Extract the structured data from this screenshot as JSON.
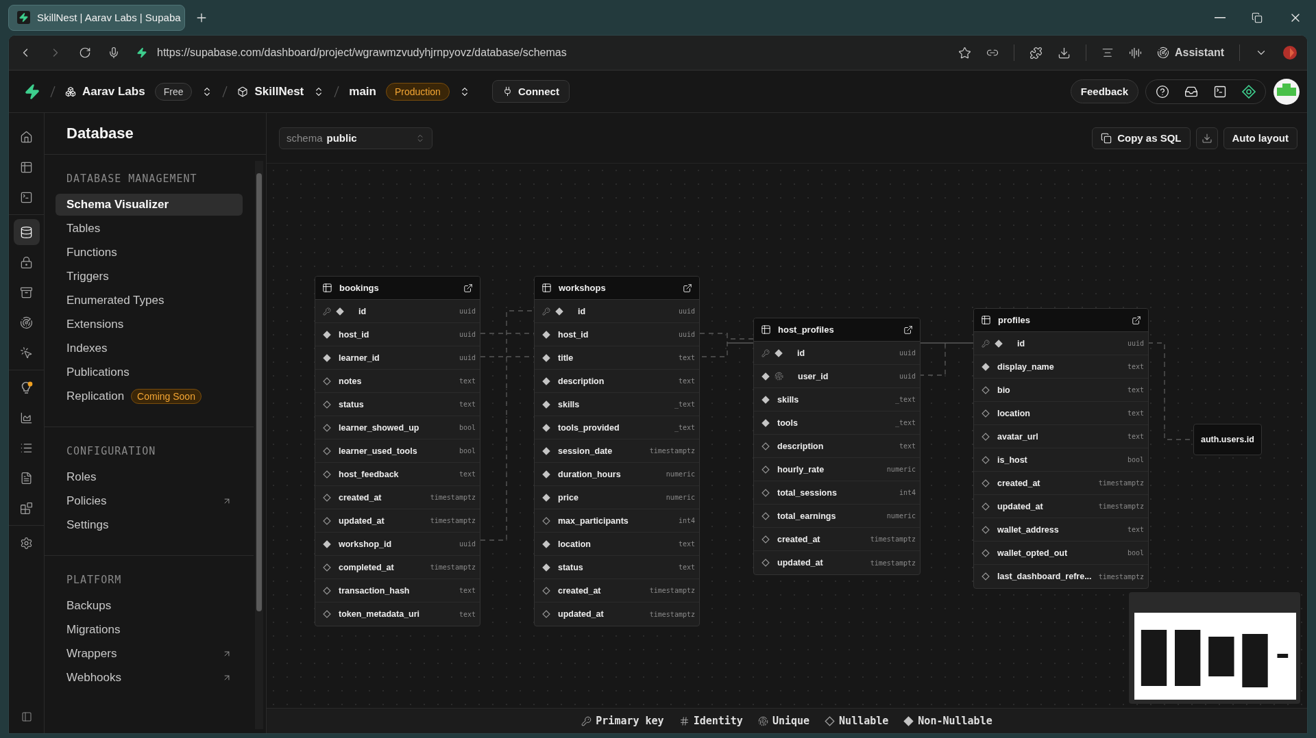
{
  "browser": {
    "tab_title": "SkillNest | Aarav Labs | Supaba",
    "url": "https://supabase.com/dashboard/project/wgrawmzvudyhjrnpyovz/database/schemas",
    "assistant": "Assistant"
  },
  "header": {
    "org": "Aarav Labs",
    "plan": "Free",
    "project": "SkillNest",
    "branch": "main",
    "environment": "Production",
    "connect": "Connect",
    "feedback": "Feedback"
  },
  "rail_groups": [
    {
      "items": [
        {
          "kind": "home",
          "selected": false
        },
        {
          "kind": "table",
          "selected": false
        },
        {
          "kind": "terminal",
          "selected": false
        }
      ]
    },
    {
      "items": [
        {
          "kind": "database",
          "selected": true
        },
        {
          "kind": "auth",
          "selected": false
        },
        {
          "kind": "storage",
          "selected": false
        },
        {
          "kind": "realtime",
          "selected": false
        },
        {
          "kind": "functions",
          "selected": false
        }
      ]
    },
    {
      "items": [
        {
          "kind": "advisor",
          "selected": false
        },
        {
          "kind": "reports",
          "selected": false
        },
        {
          "kind": "logs",
          "selected": false
        },
        {
          "kind": "docs",
          "selected": false
        },
        {
          "kind": "integrations",
          "selected": false
        }
      ]
    },
    {
      "items": [
        {
          "kind": "settings",
          "selected": false
        }
      ]
    }
  ],
  "sidebar": {
    "title": "Database",
    "sections": [
      {
        "heading": "DATABASE MANAGEMENT",
        "items": [
          {
            "label": "Schema Visualizer",
            "selected": true
          },
          {
            "label": "Tables",
            "selected": false
          },
          {
            "label": "Functions",
            "selected": false
          },
          {
            "label": "Triggers",
            "selected": false
          },
          {
            "label": "Enumerated Types",
            "selected": false
          },
          {
            "label": "Extensions",
            "selected": false
          },
          {
            "label": "Indexes",
            "selected": false
          },
          {
            "label": "Publications",
            "selected": false
          },
          {
            "label": "Replication",
            "selected": false,
            "badge": "Coming Soon"
          }
        ]
      },
      {
        "heading": "CONFIGURATION",
        "items": [
          {
            "label": "Roles",
            "selected": false
          },
          {
            "label": "Policies",
            "selected": false,
            "external": true
          },
          {
            "label": "Settings",
            "selected": false
          }
        ]
      },
      {
        "heading": "PLATFORM",
        "items": [
          {
            "label": "Backups",
            "selected": false
          },
          {
            "label": "Migrations",
            "selected": false
          },
          {
            "label": "Wrappers",
            "selected": false,
            "external": true
          },
          {
            "label": "Webhooks",
            "selected": false,
            "external": true
          }
        ]
      }
    ]
  },
  "toolbar": {
    "schema_label": "schema",
    "schema_value": "public",
    "copy_sql": "Copy as SQL",
    "auto_layout": "Auto layout"
  },
  "tables": [
    {
      "name": "bookings",
      "columns": [
        {
          "name": "id",
          "type": "uuid",
          "primary_key": true,
          "unique": false,
          "nullable": false
        },
        {
          "name": "host_id",
          "type": "uuid",
          "primary_key": false,
          "unique": false,
          "nullable": false
        },
        {
          "name": "learner_id",
          "type": "uuid",
          "primary_key": false,
          "unique": false,
          "nullable": false
        },
        {
          "name": "notes",
          "type": "text",
          "primary_key": false,
          "unique": false,
          "nullable": true
        },
        {
          "name": "status",
          "type": "text",
          "primary_key": false,
          "unique": false,
          "nullable": true
        },
        {
          "name": "learner_showed_up",
          "type": "bool",
          "primary_key": false,
          "unique": false,
          "nullable": true
        },
        {
          "name": "learner_used_tools",
          "type": "bool",
          "primary_key": false,
          "unique": false,
          "nullable": true
        },
        {
          "name": "host_feedback",
          "type": "text",
          "primary_key": false,
          "unique": false,
          "nullable": true
        },
        {
          "name": "created_at",
          "type": "timestamptz",
          "primary_key": false,
          "unique": false,
          "nullable": true
        },
        {
          "name": "updated_at",
          "type": "timestamptz",
          "primary_key": false,
          "unique": false,
          "nullable": true
        },
        {
          "name": "workshop_id",
          "type": "uuid",
          "primary_key": false,
          "unique": false,
          "nullable": false
        },
        {
          "name": "completed_at",
          "type": "timestamptz",
          "primary_key": false,
          "unique": false,
          "nullable": true
        },
        {
          "name": "transaction_hash",
          "type": "text",
          "primary_key": false,
          "unique": false,
          "nullable": true
        },
        {
          "name": "token_metadata_uri",
          "type": "text",
          "primary_key": false,
          "unique": false,
          "nullable": true
        }
      ]
    },
    {
      "name": "workshops",
      "columns": [
        {
          "name": "id",
          "type": "uuid",
          "primary_key": true,
          "unique": false,
          "nullable": false
        },
        {
          "name": "host_id",
          "type": "uuid",
          "primary_key": false,
          "unique": false,
          "nullable": false
        },
        {
          "name": "title",
          "type": "text",
          "primary_key": false,
          "unique": false,
          "nullable": false
        },
        {
          "name": "description",
          "type": "text",
          "primary_key": false,
          "unique": false,
          "nullable": false
        },
        {
          "name": "skills",
          "type": "_text",
          "primary_key": false,
          "unique": false,
          "nullable": false
        },
        {
          "name": "tools_provided",
          "type": "_text",
          "primary_key": false,
          "unique": false,
          "nullable": false
        },
        {
          "name": "session_date",
          "type": "timestamptz",
          "primary_key": false,
          "unique": false,
          "nullable": false
        },
        {
          "name": "duration_hours",
          "type": "numeric",
          "primary_key": false,
          "unique": false,
          "nullable": false
        },
        {
          "name": "price",
          "type": "numeric",
          "primary_key": false,
          "unique": false,
          "nullable": false
        },
        {
          "name": "max_participants",
          "type": "int4",
          "primary_key": false,
          "unique": false,
          "nullable": true
        },
        {
          "name": "location",
          "type": "text",
          "primary_key": false,
          "unique": false,
          "nullable": false
        },
        {
          "name": "status",
          "type": "text",
          "primary_key": false,
          "unique": false,
          "nullable": false
        },
        {
          "name": "created_at",
          "type": "timestamptz",
          "primary_key": false,
          "unique": false,
          "nullable": true
        },
        {
          "name": "updated_at",
          "type": "timestamptz",
          "primary_key": false,
          "unique": false,
          "nullable": true
        }
      ]
    },
    {
      "name": "host_profiles",
      "columns": [
        {
          "name": "id",
          "type": "uuid",
          "primary_key": true,
          "unique": false,
          "nullable": false
        },
        {
          "name": "user_id",
          "type": "uuid",
          "primary_key": false,
          "unique": true,
          "nullable": false
        },
        {
          "name": "skills",
          "type": "_text",
          "primary_key": false,
          "unique": false,
          "nullable": false
        },
        {
          "name": "tools",
          "type": "_text",
          "primary_key": false,
          "unique": false,
          "nullable": false
        },
        {
          "name": "description",
          "type": "text",
          "primary_key": false,
          "unique": false,
          "nullable": true
        },
        {
          "name": "hourly_rate",
          "type": "numeric",
          "primary_key": false,
          "unique": false,
          "nullable": true
        },
        {
          "name": "total_sessions",
          "type": "int4",
          "primary_key": false,
          "unique": false,
          "nullable": true
        },
        {
          "name": "total_earnings",
          "type": "numeric",
          "primary_key": false,
          "unique": false,
          "nullable": true
        },
        {
          "name": "created_at",
          "type": "timestamptz",
          "primary_key": false,
          "unique": false,
          "nullable": true
        },
        {
          "name": "updated_at",
          "type": "timestamptz",
          "primary_key": false,
          "unique": false,
          "nullable": true
        }
      ]
    },
    {
      "name": "profiles",
      "columns": [
        {
          "name": "id",
          "type": "uuid",
          "primary_key": true,
          "unique": false,
          "nullable": false
        },
        {
          "name": "display_name",
          "type": "text",
          "primary_key": false,
          "unique": false,
          "nullable": false
        },
        {
          "name": "bio",
          "type": "text",
          "primary_key": false,
          "unique": false,
          "nullable": true
        },
        {
          "name": "location",
          "type": "text",
          "primary_key": false,
          "unique": false,
          "nullable": true
        },
        {
          "name": "avatar_url",
          "type": "text",
          "primary_key": false,
          "unique": false,
          "nullable": true
        },
        {
          "name": "is_host",
          "type": "bool",
          "primary_key": false,
          "unique": false,
          "nullable": true
        },
        {
          "name": "created_at",
          "type": "timestamptz",
          "primary_key": false,
          "unique": false,
          "nullable": true
        },
        {
          "name": "updated_at",
          "type": "timestamptz",
          "primary_key": false,
          "unique": false,
          "nullable": true
        },
        {
          "name": "wallet_address",
          "type": "text",
          "primary_key": false,
          "unique": false,
          "nullable": true
        },
        {
          "name": "wallet_opted_out",
          "type": "bool",
          "primary_key": false,
          "unique": false,
          "nullable": true
        },
        {
          "name": "last_dashboard_refre...",
          "type": "timestamptz",
          "primary_key": false,
          "unique": false,
          "nullable": true
        }
      ]
    }
  ],
  "reference_nodes": [
    {
      "label": "auth.users.id"
    }
  ],
  "legend": [
    {
      "kind": "primary_key",
      "label": "Primary key"
    },
    {
      "kind": "identity",
      "label": "Identity"
    },
    {
      "kind": "unique",
      "label": "Unique"
    },
    {
      "kind": "nullable",
      "label": "Nullable"
    },
    {
      "kind": "non_nullable",
      "label": "Non-Nullable"
    }
  ]
}
